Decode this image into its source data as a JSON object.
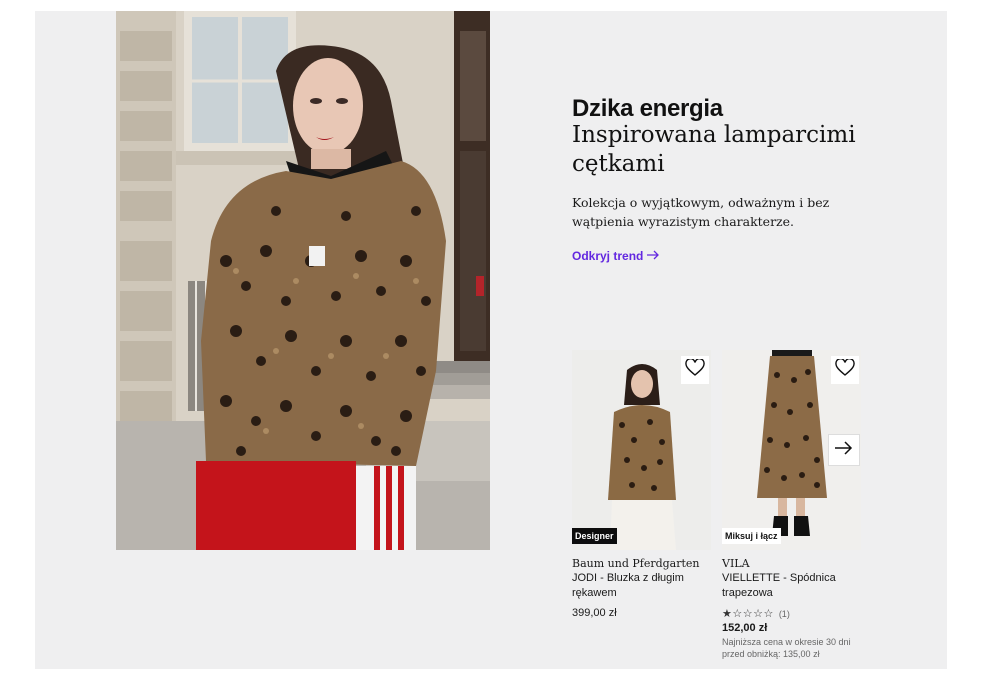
{
  "promo": {
    "heading": "Dzika energia",
    "subheading": "Inspirowana lamparcimi cętkami",
    "description": "Kolekcja o wyjątkowym, odważnym i bez wątpienia wyrazistym charakterze.",
    "cta_label": "Odkryj trend"
  },
  "products": [
    {
      "badge": "Designer",
      "brand": "Baum und Pferdgarten",
      "name": "JODI - Bluzka z długim rękawem",
      "price": "399,00 zł"
    },
    {
      "badge": "Miksuj i łącz",
      "brand": "VILA",
      "name": "VIELLETTE - Spódnica trapezowa",
      "rating_stars": "★☆☆☆☆",
      "rating_value": 1,
      "rating_count": "(1)",
      "price": "152,00 zł",
      "price_note": "Najniższa cena w okresie 30 dni przed obniżką: 135,00 zł"
    }
  ],
  "colors": {
    "accent": "#6328e0",
    "panel_bg": "#efeff0",
    "badge_dark": "#0d0d0d"
  },
  "icons": {
    "favorite": "heart-outline-icon",
    "next": "arrow-right-icon",
    "cta": "arrow-right-icon"
  }
}
